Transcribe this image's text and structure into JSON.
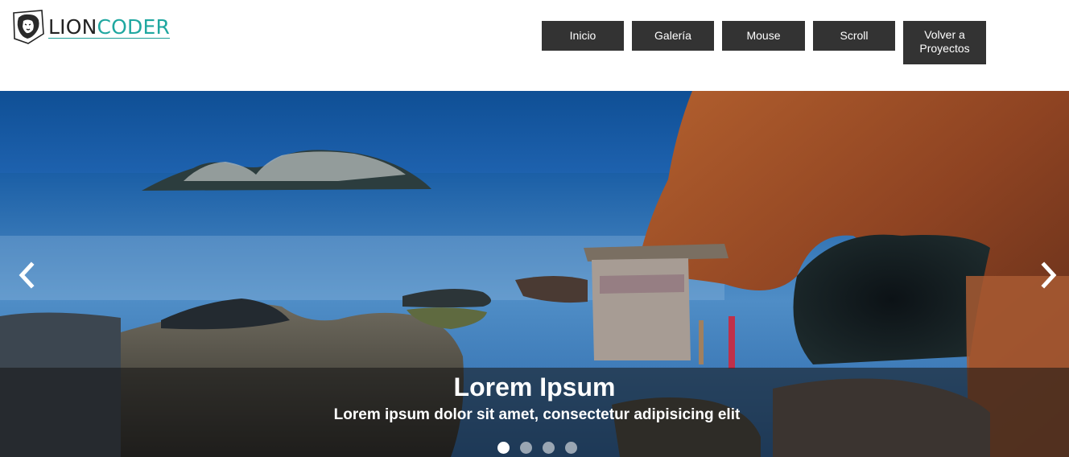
{
  "logo": {
    "part1": "LION",
    "part2": "CODER",
    "icon": "lion-shield-icon"
  },
  "nav": {
    "items": [
      {
        "label": "Inicio"
      },
      {
        "label": "Galería"
      },
      {
        "label": "Mouse"
      },
      {
        "label": "Scroll"
      },
      {
        "label": "Volver a Proyectos"
      }
    ]
  },
  "carousel": {
    "title": "Lorem Ipsum",
    "text": "Lorem ipsum dolor sit amet, consectetur adipisicing elit",
    "prev_icon": "chevron-left-icon",
    "next_icon": "chevron-right-icon",
    "slides_count": 4,
    "active_index": 0
  },
  "colors": {
    "nav_bg": "#333333",
    "logo_accent": "#1fa7a0",
    "sea": "#1f5fa5",
    "rock": "#9c4a22"
  }
}
